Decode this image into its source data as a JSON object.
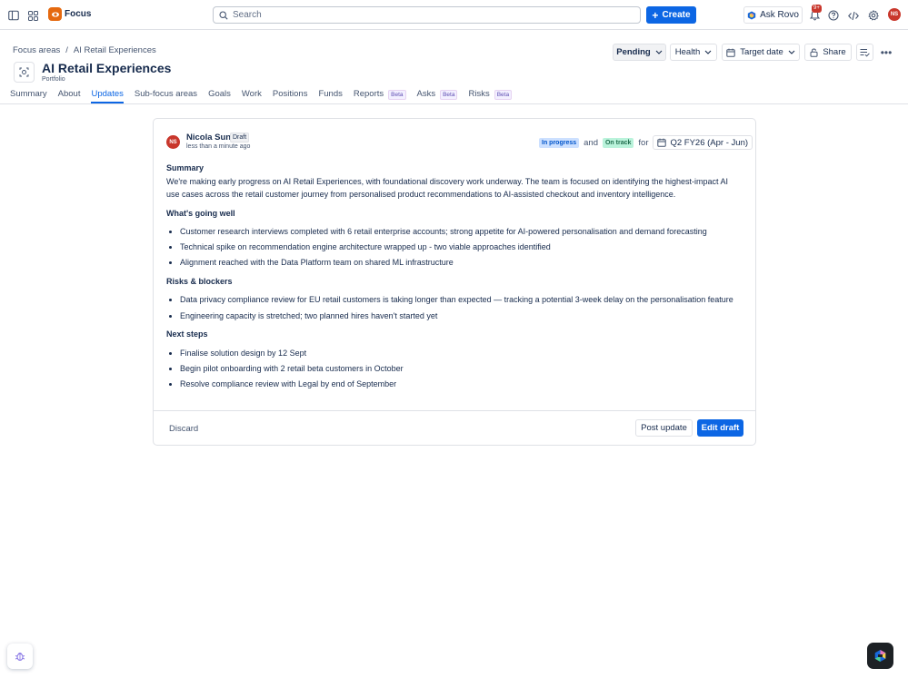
{
  "topbar": {
    "app_name": "Focus",
    "search_placeholder": "Search",
    "create_label": "Create",
    "ask_rovo_label": "Ask Rovo",
    "notification_count": "9+",
    "user_initials": "NS"
  },
  "breadcrumb": {
    "root": "Focus areas",
    "separator": "/",
    "current": "AI Retail Experiences"
  },
  "header": {
    "title": "AI Retail Experiences",
    "subtitle": "Portfolio",
    "pending_label": "Pending",
    "health_label": "Health",
    "target_date_label": "Target date",
    "share_label": "Share"
  },
  "tabs": [
    {
      "label": "Summary",
      "beta": ""
    },
    {
      "label": "About",
      "beta": ""
    },
    {
      "label": "Updates",
      "beta": "",
      "active": true
    },
    {
      "label": "Sub-focus areas",
      "beta": ""
    },
    {
      "label": "Goals",
      "beta": ""
    },
    {
      "label": "Work",
      "beta": ""
    },
    {
      "label": "Positions",
      "beta": ""
    },
    {
      "label": "Funds",
      "beta": ""
    },
    {
      "label": "Reports",
      "beta": "Beta"
    },
    {
      "label": "Asks",
      "beta": "Beta"
    },
    {
      "label": "Risks",
      "beta": "Beta"
    }
  ],
  "update": {
    "author_initials": "NS",
    "author_name": "Nicola Sun",
    "draft_label": "Draft",
    "time": "less than a minute ago",
    "status_in_progress": "In progress",
    "status_and": "and",
    "status_on_track": "On track",
    "status_for": "for",
    "target_period": "Q2 FY26 (Apr - Jun)",
    "summary_heading": "Summary",
    "summary_text": "We're making early progress on AI Retail Experiences, with foundational discovery work underway. The team is focused on identifying the highest-impact AI use cases across the retail customer journey from personalised product recommendations to AI-assisted checkout and inventory intelligence.",
    "going_well_heading": "What's going well",
    "going_well": [
      "Customer research interviews completed with 6 retail enterprise accounts; strong appetite for AI-powered personalisation and demand forecasting",
      "Technical spike on recommendation engine architecture wrapped up - two viable approaches identified",
      "Alignment reached with the Data Platform team on shared ML infrastructure"
    ],
    "risks_heading": "Risks & blockers",
    "risks": [
      "Data privacy compliance review for EU retail customers is taking longer than expected — tracking a potential 3-week delay on the personalisation feature",
      "Engineering capacity is stretched; two planned hires haven't started yet"
    ],
    "next_heading": "Next steps",
    "next_steps": [
      "Finalise solution design by 12 Sept",
      "Begin pilot onboarding with 2 retail beta customers in October",
      "Resolve compliance review with Legal by end of September"
    ],
    "discard_label": "Discard",
    "post_label": "Post update",
    "edit_label": "Edit draft"
  },
  "colors": {
    "brand_blue": "#0c66e4",
    "avatar_red": "#c9372c",
    "logo_orange": "#e56910"
  }
}
